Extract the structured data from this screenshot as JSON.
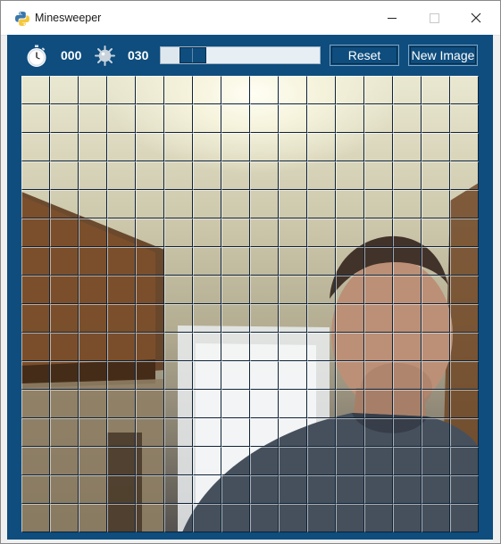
{
  "window": {
    "title": "Minesweeper",
    "controls": {
      "minimize": "minimize-icon",
      "maximize": "maximize-icon",
      "close": "close-icon"
    }
  },
  "toolbar": {
    "timer_icon": "stopwatch-icon",
    "time_display": "000",
    "mine_icon": "mine-icon",
    "mine_count": "030",
    "progress": {
      "fraction": 0.12
    },
    "reset_label": "Reset",
    "new_image_label": "New Image"
  },
  "board": {
    "rows": 16,
    "cols": 16,
    "state": "all cells unrevealed"
  },
  "colors": {
    "panel": "#0e4d7e",
    "cell_dark_edge": "#0d2237",
    "button_text": "#ffffff"
  }
}
